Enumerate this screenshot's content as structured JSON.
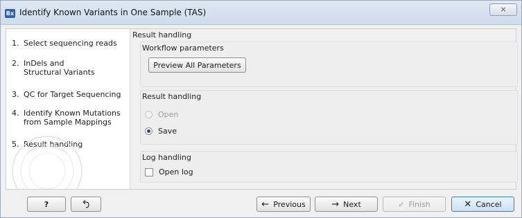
{
  "window": {
    "icon_text": "Bx",
    "title": "Identify Known Variants in One Sample (TAS)",
    "close_glyph": "⨯"
  },
  "steps": [
    {
      "num": "1.",
      "label": "Select sequencing reads"
    },
    {
      "num": "2.",
      "label": "InDels and Structural Variants"
    },
    {
      "num": "3.",
      "label": "QC for Target Sequencing"
    },
    {
      "num": "4.",
      "label": "Identify Known Mutations from Sample Mappings"
    },
    {
      "num": "5.",
      "label": "Result handling"
    }
  ],
  "main": {
    "heading": "Result handling",
    "workflow_params": {
      "title": "Workflow parameters",
      "button_label": "Preview All Parameters"
    },
    "result_handling": {
      "title": "Result handling",
      "options": [
        {
          "label": "Open",
          "selected": false,
          "enabled": false
        },
        {
          "label": "Save",
          "selected": true,
          "enabled": true
        }
      ]
    },
    "log_handling": {
      "title": "Log handling",
      "checkbox_label": "Open log",
      "checked": false
    }
  },
  "footer": {
    "help_label": "?",
    "reset_icon": "undo-arrow-icon",
    "previous_label": "Previous",
    "next_label": "Next",
    "finish_label": "Finish",
    "cancel_label": "Cancel"
  }
}
